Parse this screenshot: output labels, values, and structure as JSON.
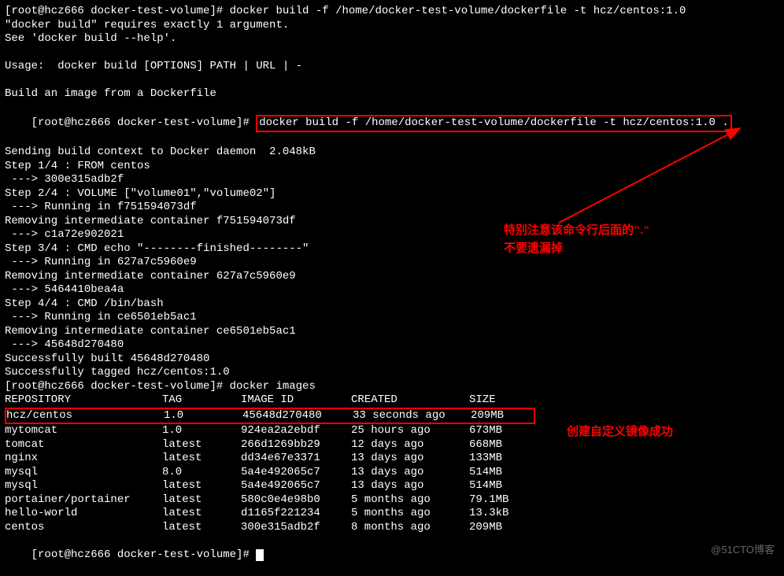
{
  "prompt": {
    "user": "root",
    "host": "hcz666",
    "dir": "docker-test-volume"
  },
  "lines": {
    "cmd1": "[root@hcz666 docker-test-volume]# docker build -f /home/docker-test-volume/dockerfile -t hcz/centos:1.0",
    "err1": "\"docker build\" requires exactly 1 argument.",
    "err2": "See 'docker build --help'.",
    "usage": "Usage:  docker build [OPTIONS] PATH | URL | -",
    "desc": "Build an image from a Dockerfile",
    "prompt2": "[root@hcz666 docker-test-volume]# ",
    "cmd2": "docker build -f /home/docker-test-volume/dockerfile -t hcz/centos:1.0 .",
    "b1": "Sending build context to Docker daemon  2.048kB",
    "b2": "Step 1/4 : FROM centos",
    "b3": " ---> 300e315adb2f",
    "b4": "Step 2/4 : VOLUME [\"volume01\",\"volume02\"]",
    "b5": " ---> Running in f751594073df",
    "b6": "Removing intermediate container f751594073df",
    "b7": " ---> c1a72e902021",
    "b8": "Step 3/4 : CMD echo \"--------finished--------\"",
    "b9": " ---> Running in 627a7c5960e9",
    "b10": "Removing intermediate container 627a7c5960e9",
    "b11": " ---> 5464410bea4a",
    "b12": "Step 4/4 : CMD /bin/bash",
    "b13": " ---> Running in ce6501eb5ac1",
    "b14": "Removing intermediate container ce6501eb5ac1",
    "b15": " ---> 45648d270480",
    "b16": "Successfully built 45648d270480",
    "b17": "Successfully tagged hcz/centos:1.0",
    "cmd3": "[root@hcz666 docker-test-volume]# docker images",
    "prompt3": "[root@hcz666 docker-test-volume]# "
  },
  "table": {
    "headers": {
      "repo": "REPOSITORY",
      "tag": "TAG",
      "imageid": "IMAGE ID",
      "created": "CREATED",
      "size": "SIZE"
    },
    "rows": [
      {
        "repo": "hcz/centos",
        "tag": "1.0",
        "imageid": "45648d270480",
        "created": "33 seconds ago",
        "size": "209MB",
        "highlight": true
      },
      {
        "repo": "mytomcat",
        "tag": "1.0",
        "imageid": "924ea2a2ebdf",
        "created": "25 hours ago",
        "size": "673MB"
      },
      {
        "repo": "tomcat",
        "tag": "latest",
        "imageid": "266d1269bb29",
        "created": "12 days ago",
        "size": "668MB"
      },
      {
        "repo": "nginx",
        "tag": "latest",
        "imageid": "dd34e67e3371",
        "created": "13 days ago",
        "size": "133MB"
      },
      {
        "repo": "mysql",
        "tag": "8.0",
        "imageid": "5a4e492065c7",
        "created": "13 days ago",
        "size": "514MB"
      },
      {
        "repo": "mysql",
        "tag": "latest",
        "imageid": "5a4e492065c7",
        "created": "13 days ago",
        "size": "514MB"
      },
      {
        "repo": "portainer/portainer",
        "tag": "latest",
        "imageid": "580c0e4e98b0",
        "created": "5 months ago",
        "size": "79.1MB"
      },
      {
        "repo": "hello-world",
        "tag": "latest",
        "imageid": "d1165f221234",
        "created": "5 months ago",
        "size": "13.3kB"
      },
      {
        "repo": "centos",
        "tag": "latest",
        "imageid": "300e315adb2f",
        "created": "8 months ago",
        "size": "209MB"
      }
    ]
  },
  "annotations": {
    "a1": "特别注意该命令行后面的\".\"",
    "a2": "不要遗漏掉",
    "a3": "创建自定义镜像成功"
  },
  "watermark": "@51CTO博客"
}
